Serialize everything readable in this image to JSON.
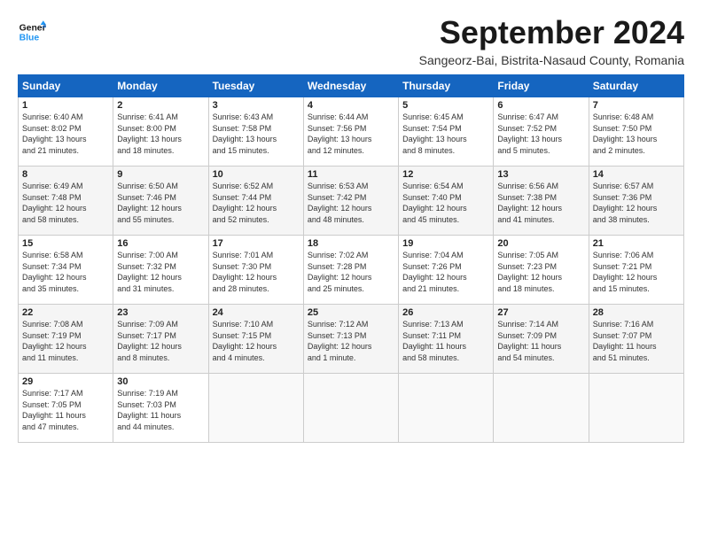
{
  "header": {
    "logo_line1": "General",
    "logo_line2": "Blue",
    "title": "September 2024",
    "subtitle": "Sangeorz-Bai, Bistrita-Nasaud County, Romania"
  },
  "weekdays": [
    "Sunday",
    "Monday",
    "Tuesday",
    "Wednesday",
    "Thursday",
    "Friday",
    "Saturday"
  ],
  "weeks": [
    [
      {
        "day": "1",
        "info": "Sunrise: 6:40 AM\nSunset: 8:02 PM\nDaylight: 13 hours\nand 21 minutes."
      },
      {
        "day": "2",
        "info": "Sunrise: 6:41 AM\nSunset: 8:00 PM\nDaylight: 13 hours\nand 18 minutes."
      },
      {
        "day": "3",
        "info": "Sunrise: 6:43 AM\nSunset: 7:58 PM\nDaylight: 13 hours\nand 15 minutes."
      },
      {
        "day": "4",
        "info": "Sunrise: 6:44 AM\nSunset: 7:56 PM\nDaylight: 13 hours\nand 12 minutes."
      },
      {
        "day": "5",
        "info": "Sunrise: 6:45 AM\nSunset: 7:54 PM\nDaylight: 13 hours\nand 8 minutes."
      },
      {
        "day": "6",
        "info": "Sunrise: 6:47 AM\nSunset: 7:52 PM\nDaylight: 13 hours\nand 5 minutes."
      },
      {
        "day": "7",
        "info": "Sunrise: 6:48 AM\nSunset: 7:50 PM\nDaylight: 13 hours\nand 2 minutes."
      }
    ],
    [
      {
        "day": "8",
        "info": "Sunrise: 6:49 AM\nSunset: 7:48 PM\nDaylight: 12 hours\nand 58 minutes."
      },
      {
        "day": "9",
        "info": "Sunrise: 6:50 AM\nSunset: 7:46 PM\nDaylight: 12 hours\nand 55 minutes."
      },
      {
        "day": "10",
        "info": "Sunrise: 6:52 AM\nSunset: 7:44 PM\nDaylight: 12 hours\nand 52 minutes."
      },
      {
        "day": "11",
        "info": "Sunrise: 6:53 AM\nSunset: 7:42 PM\nDaylight: 12 hours\nand 48 minutes."
      },
      {
        "day": "12",
        "info": "Sunrise: 6:54 AM\nSunset: 7:40 PM\nDaylight: 12 hours\nand 45 minutes."
      },
      {
        "day": "13",
        "info": "Sunrise: 6:56 AM\nSunset: 7:38 PM\nDaylight: 12 hours\nand 41 minutes."
      },
      {
        "day": "14",
        "info": "Sunrise: 6:57 AM\nSunset: 7:36 PM\nDaylight: 12 hours\nand 38 minutes."
      }
    ],
    [
      {
        "day": "15",
        "info": "Sunrise: 6:58 AM\nSunset: 7:34 PM\nDaylight: 12 hours\nand 35 minutes."
      },
      {
        "day": "16",
        "info": "Sunrise: 7:00 AM\nSunset: 7:32 PM\nDaylight: 12 hours\nand 31 minutes."
      },
      {
        "day": "17",
        "info": "Sunrise: 7:01 AM\nSunset: 7:30 PM\nDaylight: 12 hours\nand 28 minutes."
      },
      {
        "day": "18",
        "info": "Sunrise: 7:02 AM\nSunset: 7:28 PM\nDaylight: 12 hours\nand 25 minutes."
      },
      {
        "day": "19",
        "info": "Sunrise: 7:04 AM\nSunset: 7:26 PM\nDaylight: 12 hours\nand 21 minutes."
      },
      {
        "day": "20",
        "info": "Sunrise: 7:05 AM\nSunset: 7:23 PM\nDaylight: 12 hours\nand 18 minutes."
      },
      {
        "day": "21",
        "info": "Sunrise: 7:06 AM\nSunset: 7:21 PM\nDaylight: 12 hours\nand 15 minutes."
      }
    ],
    [
      {
        "day": "22",
        "info": "Sunrise: 7:08 AM\nSunset: 7:19 PM\nDaylight: 12 hours\nand 11 minutes."
      },
      {
        "day": "23",
        "info": "Sunrise: 7:09 AM\nSunset: 7:17 PM\nDaylight: 12 hours\nand 8 minutes."
      },
      {
        "day": "24",
        "info": "Sunrise: 7:10 AM\nSunset: 7:15 PM\nDaylight: 12 hours\nand 4 minutes."
      },
      {
        "day": "25",
        "info": "Sunrise: 7:12 AM\nSunset: 7:13 PM\nDaylight: 12 hours\nand 1 minute."
      },
      {
        "day": "26",
        "info": "Sunrise: 7:13 AM\nSunset: 7:11 PM\nDaylight: 11 hours\nand 58 minutes."
      },
      {
        "day": "27",
        "info": "Sunrise: 7:14 AM\nSunset: 7:09 PM\nDaylight: 11 hours\nand 54 minutes."
      },
      {
        "day": "28",
        "info": "Sunrise: 7:16 AM\nSunset: 7:07 PM\nDaylight: 11 hours\nand 51 minutes."
      }
    ],
    [
      {
        "day": "29",
        "info": "Sunrise: 7:17 AM\nSunset: 7:05 PM\nDaylight: 11 hours\nand 47 minutes."
      },
      {
        "day": "30",
        "info": "Sunrise: 7:19 AM\nSunset: 7:03 PM\nDaylight: 11 hours\nand 44 minutes."
      },
      {
        "day": "",
        "info": ""
      },
      {
        "day": "",
        "info": ""
      },
      {
        "day": "",
        "info": ""
      },
      {
        "day": "",
        "info": ""
      },
      {
        "day": "",
        "info": ""
      }
    ]
  ]
}
